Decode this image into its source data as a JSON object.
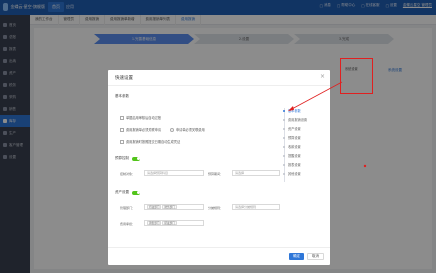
{
  "app": {
    "logo_text": "金蝶云·星空·旗舰版"
  },
  "topbar": {
    "tabs": [
      {
        "label": "首页"
      },
      {
        "label": "应用"
      }
    ],
    "right": [
      "消息",
      "帮助中心",
      "在线客服",
      "设置"
    ],
    "user": "金蝶云星空 管理员"
  },
  "sidebar": {
    "items": [
      {
        "label": "首页"
      },
      {
        "label": "总账"
      },
      {
        "label": "报表"
      },
      {
        "label": "出纳"
      },
      {
        "label": "资产"
      },
      {
        "label": "税务"
      },
      {
        "label": "采购"
      },
      {
        "label": "销售"
      },
      {
        "label": "库存"
      },
      {
        "label": "生产"
      },
      {
        "label": "客户管理"
      },
      {
        "label": "设置"
      }
    ]
  },
  "crumbs": [
    "我的工作台",
    "管理员",
    "费用报销",
    "费用报销单新增",
    "费用报销单列表",
    "费用报销"
  ],
  "steps": [
    "1.完善基础信息",
    "2.设置",
    "3.完成"
  ],
  "main_link": "系统设置",
  "dialog": {
    "title": "快速设置",
    "close_glyph": "×",
    "section_basic": "基本参数",
    "checks": [
      "单据启用审核后自动过账",
      "费用报销单必须关联申请",
      "申请单必须关联费用",
      "费用报销时按照提交日期自动生成凭证"
    ],
    "toggle_budget": "预算控制",
    "fields_row1": [
      {
        "label": "控制对象：",
        "placeholder": "请选择预算科目"
      },
      {
        "label": "预算期间：",
        "placeholder": "请选择"
      }
    ],
    "toggle_asset": "资产设置",
    "fields_row2_label": "管理部门：",
    "tags_row2": [
      "行政部门",
      "财务部门"
    ],
    "field_right_label": "分摊规则：",
    "field_right_placeholder": "请选择分摊规则",
    "fields_row3_label": "费用承担：",
    "tags_row3": [
      "销售部门",
      "研发部门"
    ],
    "vnav": [
      "基本参数",
      "费用报销设置",
      "资产设置",
      "预算设置",
      "收款设置",
      "提醒设置",
      "报表设置",
      "其他设置"
    ],
    "ok_label": "确定",
    "cancel_label": "取消"
  },
  "annotation": {
    "label": "系统设置"
  }
}
